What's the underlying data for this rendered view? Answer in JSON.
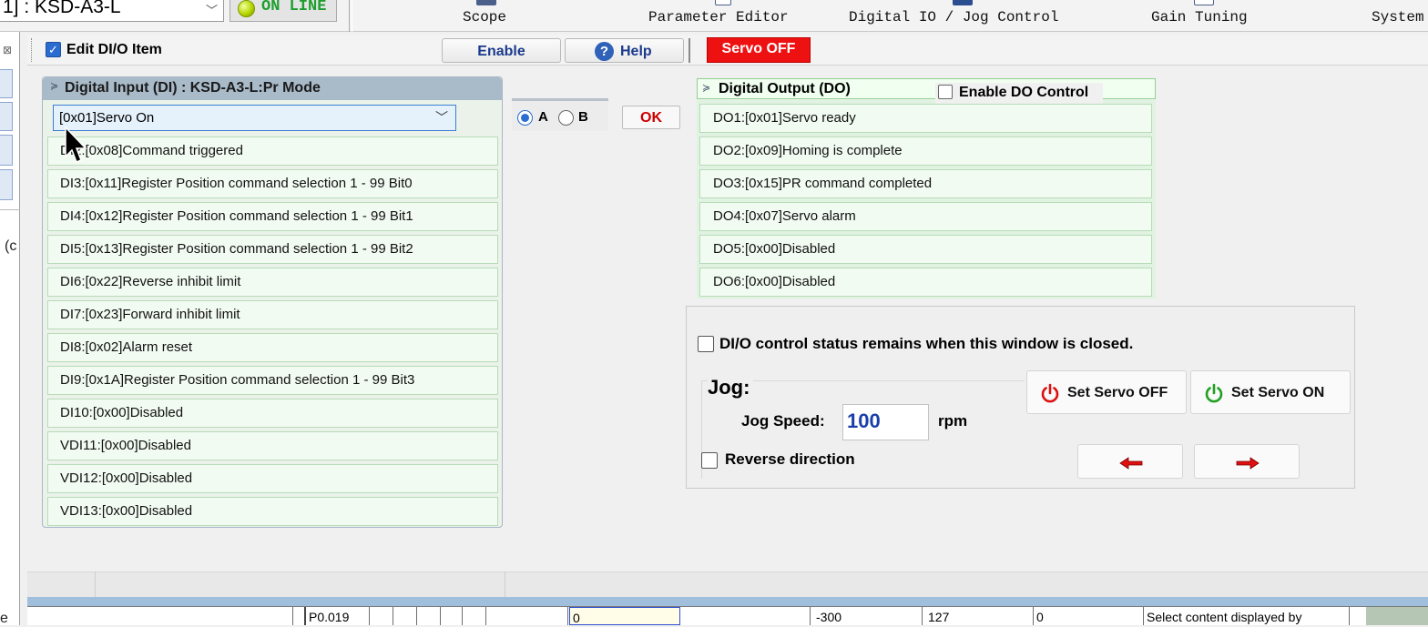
{
  "header": {
    "model_combo": "1] : KSD-A3-L",
    "online_status": "ON LINE",
    "menu": [
      "Scope",
      "Parameter Editor",
      "Digital IO / Jog Control",
      "Gain Tuning",
      "System"
    ]
  },
  "left_strip": {
    "close_glyph": "⊠",
    "text_1": "(c",
    "text_2": "e"
  },
  "panel_header": {
    "edit_label": "Edit DI/O Item",
    "edit_checked": true,
    "enable_label": "Enable",
    "help_label": "Help",
    "help_icon": "?",
    "servo_status": "Servo OFF"
  },
  "di": {
    "title": "Digital Input (DI) : KSD-A3-L:Pr Mode",
    "selected": "[0x01]Servo On",
    "rows": [
      "DI2:[0x08]Command triggered",
      "DI3:[0x11]Register Position command selection 1 - 99 Bit0",
      "DI4:[0x12]Register Position command selection 1 - 99 Bit1",
      "DI5:[0x13]Register Position command selection 1 - 99 Bit2",
      "DI6:[0x22]Reverse inhibit limit",
      "DI7:[0x23]Forward inhibit limit",
      "DI8:[0x02]Alarm reset",
      "DI9:[0x1A]Register Position command selection 1 - 99 Bit3",
      "DI10:[0x00]Disabled",
      "VDI11:[0x00]Disabled",
      "VDI12:[0x00]Disabled",
      "VDI13:[0x00]Disabled"
    ]
  },
  "ab": {
    "a_label": "A",
    "b_label": "B",
    "selected": "A",
    "ok_label": "OK"
  },
  "do": {
    "title": "Digital Output (DO)",
    "enable_label": "Enable DO Control",
    "enable_checked": false,
    "rows": [
      "DO1:[0x01]Servo ready",
      "DO2:[0x09]Homing is complete",
      "DO3:[0x15]PR command completed",
      "DO4:[0x07]Servo alarm",
      "DO5:[0x00]Disabled",
      "DO6:[0x00]Disabled"
    ]
  },
  "jog": {
    "remain_label": "DI/O control status remains when this window is closed.",
    "remain_checked": false,
    "title": "Jog:",
    "speed_label": "Jog Speed:",
    "speed_value": "100",
    "unit": "rpm",
    "reverse_label": "Reverse direction",
    "reverse_checked": false,
    "servo_off_label": "Set Servo OFF",
    "servo_on_label": "Set Servo ON"
  },
  "grid": {
    "cells": [
      "P0.019",
      "0",
      "-300",
      "127",
      "0",
      "Select content displayed by"
    ]
  },
  "colors": {
    "servo_off_bg": "#ee1111",
    "online_green": "#1e9e2e",
    "accent_blue": "#2a6cd0",
    "power_off_red": "#dd1010",
    "power_on_green": "#22a022"
  },
  "icons": {
    "online": "status-led-icon",
    "help": "help-icon",
    "servo_off": "power-icon",
    "servo_on": "power-icon",
    "jog_left": "arrow-left-icon",
    "jog_right": "arrow-right-icon",
    "dropdown": "chevron-down-icon",
    "collapse": "collapse-chevron-icon"
  }
}
